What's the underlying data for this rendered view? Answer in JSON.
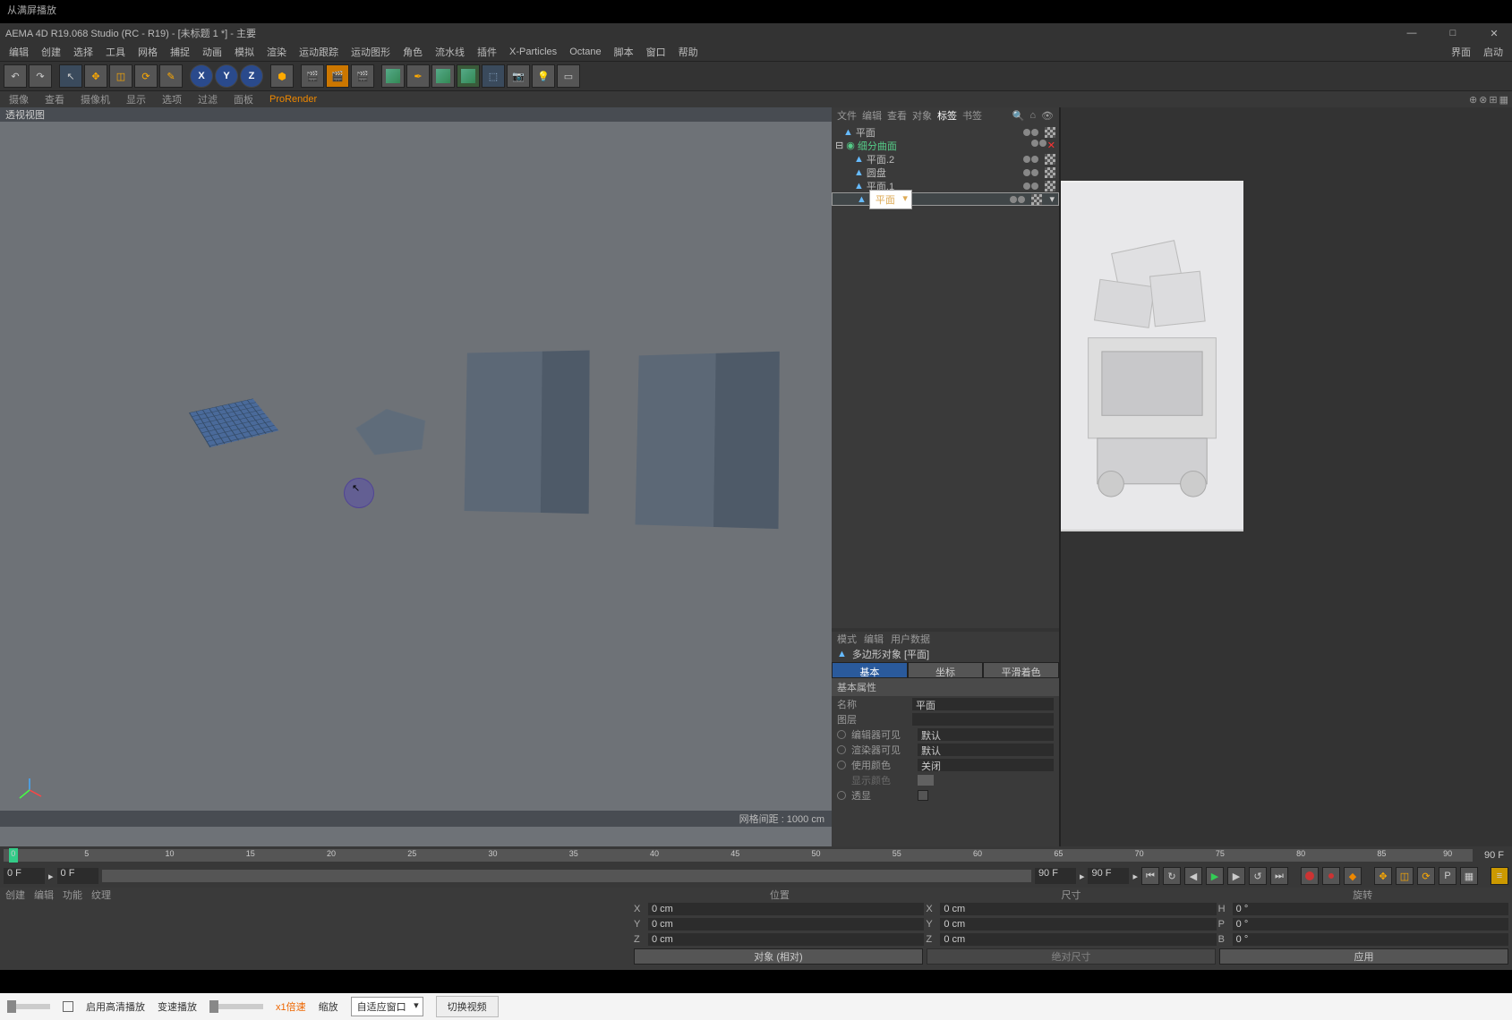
{
  "top_note": "从满屏播放",
  "title": "AEMA 4D R19.068 Studio (RC - R19) - [未标题 1 *] - 主要",
  "window_buttons": {
    "min": "—",
    "max": "□",
    "close": "✕"
  },
  "menu": [
    "编辑",
    "创建",
    "选择",
    "工具",
    "网格",
    "捕捉",
    "动画",
    "模拟",
    "渲染",
    "运动跟踪",
    "运动图形",
    "角色",
    "流水线",
    "插件",
    "X-Particles",
    "Octane",
    "脚本",
    "窗口",
    "帮助"
  ],
  "menu_right": [
    "界面",
    "启动"
  ],
  "sub_tabs": [
    "摄像",
    "查看",
    "摄像机",
    "显示",
    "选项",
    "过滤",
    "面板",
    "ProRender"
  ],
  "viewport_label": "透视视图",
  "viewport_status": "网格间距 : 1000 cm",
  "timeline_end_frame": "90 F",
  "timeline_ticks": [
    "0",
    "5",
    "10",
    "15",
    "20",
    "25",
    "30",
    "35",
    "40",
    "45",
    "50",
    "55",
    "60",
    "65",
    "70",
    "75",
    "80",
    "85",
    "90"
  ],
  "transport": {
    "start_frame": "0 F",
    "current_frame": "0 F",
    "end_frame": "90 F",
    "end_frame_2": "90 F"
  },
  "mat_tabs": [
    "创建",
    "编辑",
    "功能",
    "纹理"
  ],
  "coord": {
    "headers": [
      "位置",
      "尺寸",
      "旋转"
    ],
    "rows": [
      {
        "axis": "X",
        "pos": "0 cm",
        "size_axis": "X",
        "size": "0 cm",
        "rot_axis": "H",
        "rot": "0 °"
      },
      {
        "axis": "Y",
        "pos": "0 cm",
        "size_axis": "Y",
        "size": "0 cm",
        "rot_axis": "P",
        "rot": "0 °"
      },
      {
        "axis": "Z",
        "pos": "0 cm",
        "size_axis": "Z",
        "size": "0 cm",
        "rot_axis": "B",
        "rot": "0 °"
      }
    ],
    "mode_btn": "对象 (相对)",
    "size_btn": "绝对尺寸",
    "apply_btn": "应用"
  },
  "obj_tabs": [
    "文件",
    "编辑",
    "查看",
    "对象",
    "标签",
    "书签"
  ],
  "obj_tree": [
    {
      "name": "平面",
      "indent": 0,
      "sel": false
    },
    {
      "name": "细分曲面",
      "indent": 0,
      "sel": false,
      "green": true,
      "expander": true
    },
    {
      "name": "平面.2",
      "indent": 1,
      "sel": false
    },
    {
      "name": "圆盘",
      "indent": 1,
      "sel": false
    },
    {
      "name": "平面.1",
      "indent": 1,
      "sel": false
    },
    {
      "name": "平面",
      "indent": 1,
      "sel": true
    }
  ],
  "attr_tabs": [
    "模式",
    "编辑",
    "用户数据"
  ],
  "attr_object_label": "多边形对象 [平面]",
  "attr_mode_tabs": [
    "基本",
    "坐标",
    "平滑着色(Phong)"
  ],
  "attr_section_title": "基本属性",
  "attr_props": [
    {
      "label": "名称",
      "value": "平面",
      "type": "text"
    },
    {
      "label": "图层",
      "value": "",
      "type": "text"
    },
    {
      "label": "编辑器可见",
      "value": "默认",
      "type": "select",
      "radio": true
    },
    {
      "label": "渲染器可见",
      "value": "默认",
      "type": "select",
      "radio": true
    },
    {
      "label": "使用颜色",
      "value": "关闭",
      "type": "select",
      "radio": true
    },
    {
      "label": "显示颜色",
      "value": "",
      "type": "color",
      "disabled": true
    },
    {
      "label": "透显",
      "value": "",
      "type": "check",
      "radio": true
    }
  ],
  "video": {
    "hd_label": "启用高清播放",
    "speed_label": "变速播放",
    "speed_value": "x1倍速",
    "scale_label": "缩放",
    "scale_select": "自适应窗口",
    "switch_btn": "切换视频"
  }
}
